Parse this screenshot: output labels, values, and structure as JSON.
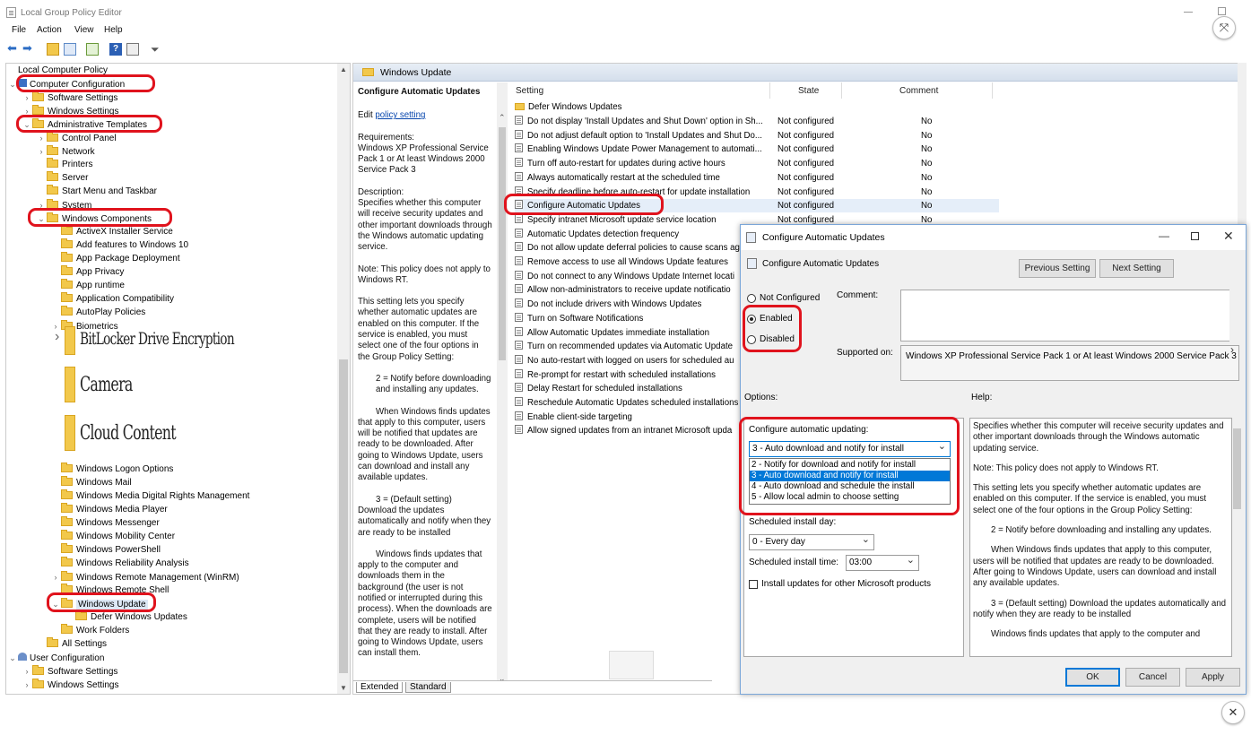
{
  "window": {
    "title": "Local Group Policy Editor"
  },
  "menu": [
    "File",
    "Action",
    "View",
    "Help"
  ],
  "tree": {
    "root": "Local Computer Policy",
    "computer_config": "Computer Configuration",
    "software_settings": "Software Settings",
    "windows_settings": "Windows Settings",
    "admin_templates": "Administrative Templates",
    "control_panel": "Control Panel",
    "network": "Network",
    "printers": "Printers",
    "server": "Server",
    "start_menu": "Start Menu and Taskbar",
    "system": "System",
    "windows_components": "Windows Components",
    "activex": "ActiveX Installer Service",
    "add_features": "Add features to Windows 10",
    "app_package": "App Package Deployment",
    "app_privacy": "App Privacy",
    "app_runtime": "App runtime",
    "app_compat": "Application Compatibility",
    "autoplay": "AutoPlay Policies",
    "biometrics": "Biometrics",
    "bitlocker": "BitLocker Drive Encryption",
    "camera": "Camera",
    "cloud": "Cloud Content",
    "logon": "Windows Logon Options",
    "mail": "Windows Mail",
    "drm": "Windows Media Digital Rights Management",
    "media_player": "Windows Media Player",
    "messenger": "Windows Messenger",
    "mobility": "Windows Mobility Center",
    "powershell": "Windows PowerShell",
    "reliability": "Windows Reliability Analysis",
    "winrm": "Windows Remote Management (WinRM)",
    "remote_shell": "Windows Remote Shell",
    "windows_update": "Windows Update",
    "defer": "Defer Windows Updates",
    "work_folders": "Work Folders",
    "all_settings": "All Settings",
    "user_config": "User Configuration",
    "user_software": "Software Settings",
    "user_windows": "Windows Settings"
  },
  "mid": {
    "header": "Windows Update",
    "desc_title": "Configure Automatic Updates",
    "edit_prefix": "Edit",
    "edit_link": "policy setting",
    "requirements": "Requirements:",
    "req_text": "Windows XP Professional Service Pack 1 or At least Windows 2000 Service Pack 3",
    "description": "Description:",
    "p1": "Specifies whether this computer will receive security updates and other important downloads through the Windows automatic updating service.",
    "p2": "Note: This policy does not apply to Windows RT.",
    "p3": "This setting lets you specify whether automatic updates are enabled on this computer. If the service is enabled, you must select one of the four options in the Group Policy Setting:",
    "p4": "2 = Notify before downloading and installing any updates.",
    "p5": "When Windows finds updates that apply to this computer, users will be notified that updates are ready to be downloaded. After going to Windows Update, users can download and install any available updates.",
    "p6": "3 = (Default setting) Download the updates automatically and notify when they are ready to be installed",
    "p7": "Windows finds updates that apply to the computer and downloads them in the background (the user is not notified or interrupted during this process). When the downloads are complete, users will be notified that they are ready to install. After going to Windows Update, users can install them.",
    "tab_extended": "Extended",
    "tab_standard": "Standard"
  },
  "list": {
    "col_setting": "Setting",
    "col_state": "State",
    "col_comment": "Comment",
    "folder": "Defer Windows Updates",
    "rows": [
      {
        "name": "Do not display 'Install Updates and Shut Down' option in Sh...",
        "state": "Not configured",
        "comment": "No"
      },
      {
        "name": "Do not adjust default option to 'Install Updates and Shut Do...",
        "state": "Not configured",
        "comment": "No"
      },
      {
        "name": "Enabling Windows Update Power Management to automati...",
        "state": "Not configured",
        "comment": "No"
      },
      {
        "name": "Turn off auto-restart for updates during active hours",
        "state": "Not configured",
        "comment": "No"
      },
      {
        "name": "Always automatically restart at the scheduled time",
        "state": "Not configured",
        "comment": "No"
      },
      {
        "name": "Specify deadline before auto-restart for update installation",
        "state": "Not configured",
        "comment": "No"
      },
      {
        "name": "Configure Automatic Updates",
        "state": "Not configured",
        "comment": "No"
      },
      {
        "name": "Specify intranet Microsoft update service location",
        "state": "Not configured",
        "comment": "No"
      },
      {
        "name": "Automatic Updates detection frequency",
        "state": "",
        "comment": ""
      },
      {
        "name": "Do not allow update deferral policies to cause scans ag",
        "state": "",
        "comment": ""
      },
      {
        "name": "Remove access to use all Windows Update features",
        "state": "",
        "comment": ""
      },
      {
        "name": "Do not connect to any Windows Update Internet locati",
        "state": "",
        "comment": ""
      },
      {
        "name": "Allow non-administrators to receive update notificatio",
        "state": "",
        "comment": ""
      },
      {
        "name": "Do not include drivers with Windows Updates",
        "state": "",
        "comment": ""
      },
      {
        "name": "Turn on Software Notifications",
        "state": "",
        "comment": ""
      },
      {
        "name": "Allow Automatic Updates immediate installation",
        "state": "",
        "comment": ""
      },
      {
        "name": "Turn on recommended updates via Automatic Update",
        "state": "",
        "comment": ""
      },
      {
        "name": "No auto-restart with logged on users for scheduled au",
        "state": "",
        "comment": ""
      },
      {
        "name": "Re-prompt for restart with scheduled installations",
        "state": "",
        "comment": ""
      },
      {
        "name": "Delay Restart for scheduled installations",
        "state": "",
        "comment": ""
      },
      {
        "name": "Reschedule Automatic Updates scheduled installations",
        "state": "",
        "comment": ""
      },
      {
        "name": "Enable client-side targeting",
        "state": "",
        "comment": ""
      },
      {
        "name": "Allow signed updates from an intranet Microsoft upda",
        "state": "",
        "comment": ""
      }
    ]
  },
  "dialog": {
    "title": "Configure Automatic Updates",
    "subtitle": "Configure Automatic Updates",
    "prev": "Previous Setting",
    "next": "Next Setting",
    "not_configured": "Not Configured",
    "enabled": "Enabled",
    "disabled": "Disabled",
    "comment_label": "Comment:",
    "supported_label": "Supported on:",
    "supported_text": "Windows XP Professional Service Pack 1 or At least Windows 2000 Service Pack 3",
    "options_label": "Options:",
    "help_label": "Help:",
    "configure_label": "Configure automatic updating:",
    "configure_value": "3 - Auto download and notify for install",
    "configure_options": [
      "2 - Notify for download and notify for install",
      "3 - Auto download and notify for install",
      "4 - Auto download and schedule the install",
      "5 - Allow local admin to choose setting"
    ],
    "day_label": "Scheduled install day:",
    "day_value": "0 - Every day",
    "time_label": "Scheduled install time:",
    "time_value": "03:00",
    "install_other": "Install updates for other Microsoft products",
    "help": {
      "h1": "Specifies whether this computer will receive security updates and other important downloads through the Windows automatic updating service.",
      "h2": "Note: This policy does not apply to Windows RT.",
      "h3": "This setting lets you specify whether automatic updates are enabled on this computer. If the service is enabled, you must select one of the four options in the Group Policy Setting:",
      "h4": "2 = Notify before downloading and installing any updates.",
      "h5": "When Windows finds updates that apply to this computer, users will be notified that updates are ready to be downloaded. After going to Windows Update, users can download and install any available updates.",
      "h6": "3 = (Default setting) Download the updates automatically and notify when they are ready to be installed",
      "h7": "Windows finds updates that apply to the computer and"
    },
    "ok": "OK",
    "cancel": "Cancel",
    "apply": "Apply"
  },
  "colors": {
    "highlight": "#e0131d",
    "selection": "#0078d7"
  }
}
